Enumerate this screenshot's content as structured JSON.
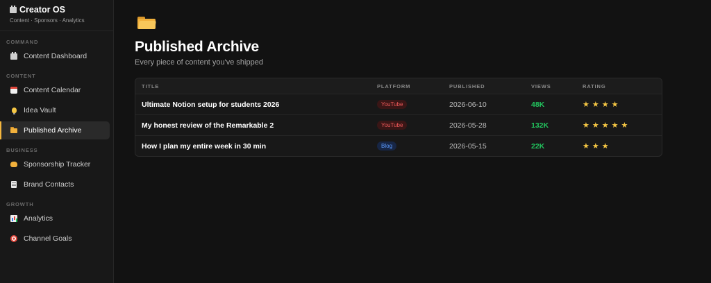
{
  "brand": {
    "title": "Creator OS",
    "subtitle": "Content · Sponsors · Analytics",
    "icon": "clapperboard-icon"
  },
  "sidebar": {
    "sections": [
      {
        "label": "COMMAND",
        "items": [
          {
            "label": "Content Dashboard",
            "icon": "clapperboard-icon",
            "active": false
          }
        ]
      },
      {
        "label": "CONTENT",
        "items": [
          {
            "label": "Content Calendar",
            "icon": "calendar-icon",
            "active": false
          },
          {
            "label": "Idea Vault",
            "icon": "lightbulb-icon",
            "active": false
          },
          {
            "label": "Published Archive",
            "icon": "folder-icon",
            "active": true
          }
        ]
      },
      {
        "label": "BUSINESS",
        "items": [
          {
            "label": "Sponsorship Tracker",
            "icon": "handshake-icon",
            "active": false
          },
          {
            "label": "Brand Contacts",
            "icon": "document-icon",
            "active": false
          }
        ]
      },
      {
        "label": "GROWTH",
        "items": [
          {
            "label": "Analytics",
            "icon": "bar-chart-icon",
            "active": false
          },
          {
            "label": "Channel Goals",
            "icon": "target-icon",
            "active": false
          }
        ]
      }
    ]
  },
  "page": {
    "icon": "folder-icon",
    "title": "Published Archive",
    "subtitle": "Every piece of content you've shipped"
  },
  "table": {
    "columns": [
      "TITLE",
      "PLATFORM",
      "PUBLISHED",
      "VIEWS",
      "RATING"
    ],
    "rows": [
      {
        "title": "Ultimate Notion setup for students 2026",
        "platform": "YouTube",
        "published": "2026-06-10",
        "views": "48K",
        "rating": 4
      },
      {
        "title": "My honest review of the Remarkable 2",
        "platform": "YouTube",
        "published": "2026-05-28",
        "views": "132K",
        "rating": 5
      },
      {
        "title": "How I plan my entire week in 30 min",
        "platform": "Blog",
        "published": "2026-05-15",
        "views": "22K",
        "rating": 3
      }
    ]
  },
  "colors": {
    "accent": "#f4b63e",
    "views": "#22c55e",
    "youtube_badge": "#ef5a5a",
    "blog_badge": "#5b9bff",
    "star": "#f6c744"
  }
}
